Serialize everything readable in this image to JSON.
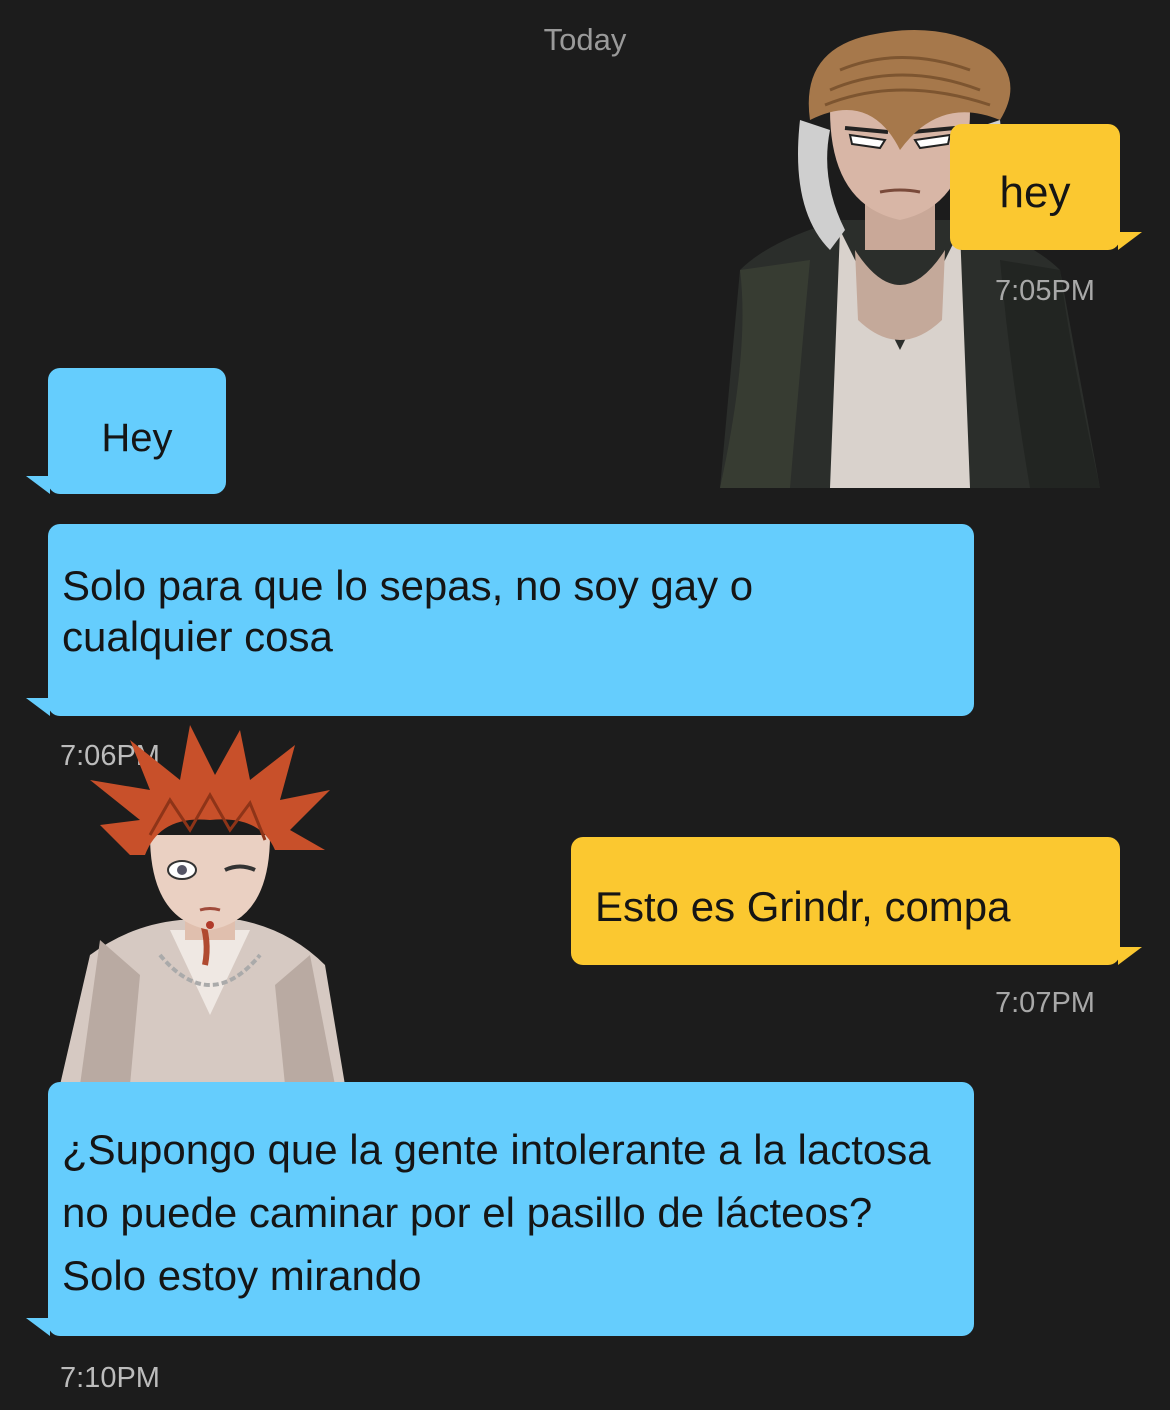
{
  "date_header": "Today",
  "messages": [
    {
      "direction": "outgoing",
      "text": "hey",
      "time": "7:05PM"
    },
    {
      "direction": "incoming",
      "text": "Hey",
      "time": ""
    },
    {
      "direction": "incoming",
      "text": "Solo para que lo sepas, no soy gay o cualquier cosa",
      "time": "7:06PM"
    },
    {
      "direction": "outgoing",
      "text": "Esto es Grindr, compa",
      "time": "7:07PM"
    },
    {
      "direction": "incoming",
      "text": "¿Supongo que la gente intolerante a la lactosa no puede caminar por el pasillo de lácteos? Solo estoy mirando",
      "time": "7:10PM"
    }
  ],
  "colors": {
    "background": "#1c1c1c",
    "outgoing_bubble": "#fbc830",
    "incoming_bubble": "#65cdfd",
    "timestamp": "#a8a8a8"
  },
  "overlays": [
    {
      "name": "character-sticker-pompadour",
      "description_icon": "anime-character-pompadour-icon"
    },
    {
      "name": "character-sticker-redhead",
      "description_icon": "anime-character-redhead-icon"
    }
  ]
}
